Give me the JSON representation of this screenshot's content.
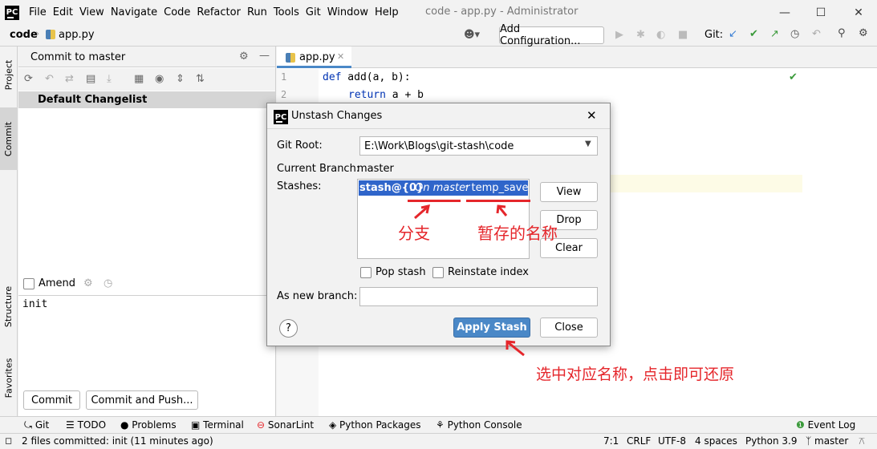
{
  "menubar": {
    "items": [
      "File",
      "Edit",
      "View",
      "Navigate",
      "Code",
      "Refactor",
      "Run",
      "Tools",
      "Git",
      "Window",
      "Help"
    ],
    "title": "code - app.py - Administrator"
  },
  "navbar": {
    "crumb_root": "code",
    "crumb_file": "app.py",
    "add_config": "Add Configuration...",
    "git_label": "Git:"
  },
  "sidebar_tabs": {
    "project": "Project",
    "commit": "Commit",
    "structure": "Structure",
    "favorites": "Favorites"
  },
  "commit": {
    "header": "Commit to master",
    "changelist": "Default Changelist",
    "amend": "Amend",
    "message": "init",
    "commit_btn": "Commit",
    "commit_push_btn": "Commit and Push..."
  },
  "editor": {
    "tab": "app.py",
    "lines": [
      {
        "num": "1",
        "kw": "def",
        "rest": " add(a, b):"
      },
      {
        "num": "2",
        "kw": "return",
        "rest": " a + b"
      }
    ]
  },
  "dialog": {
    "title": "Unstash Changes",
    "git_root_label": "Git Root:",
    "git_root_value": "E:\\Work\\Blogs\\git-stash\\code",
    "branch_label": "Current Branch:",
    "branch_value": "master",
    "stashes_label": "Stashes:",
    "stash_ref": "stash@{0}",
    "stash_sep": ": ",
    "stash_branch": "On master",
    "stash_name": ": temp_save",
    "view_btn": "View",
    "drop_btn": "Drop",
    "clear_btn": "Clear",
    "pop_label": "Pop stash",
    "reinstate_label": "Reinstate index",
    "new_branch_label": "As new branch:",
    "help": "?",
    "apply_btn": "Apply Stash",
    "close_btn": "Close"
  },
  "annotations": {
    "branch": "分支",
    "stash_name": "暂存的名称",
    "instruction": "选中对应名称，点击即可还原"
  },
  "toolwindows": [
    "Git",
    "TODO",
    "Problems",
    "Terminal",
    "SonarLint",
    "Python Packages",
    "Python Console"
  ],
  "event_log": "Event Log",
  "status": {
    "message": "2 files committed: init (11 minutes ago)",
    "position": "7:1",
    "line_sep": "CRLF",
    "encoding": "UTF-8",
    "indent": "4 spaces",
    "interpreter": "Python 3.9",
    "branch": "master"
  },
  "colors": {
    "accent": "#4a88c7",
    "annotation": "#e5262b",
    "keyword": "#0033b3",
    "selection": "#2f65ca"
  }
}
